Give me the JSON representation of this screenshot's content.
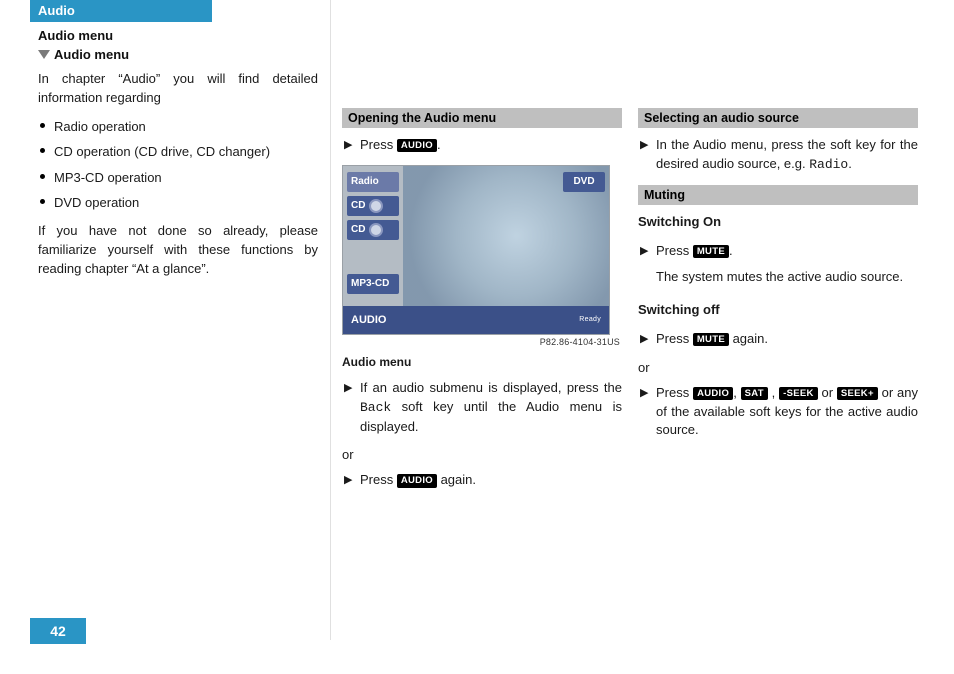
{
  "tab_title": "Audio",
  "page_number": "42",
  "col1": {
    "h1": "Audio menu",
    "h2": "Audio menu",
    "intro": "In chapter “Audio” you will find detailed information regarding",
    "bullets": [
      "Radio operation",
      "CD operation (CD drive, CD changer)",
      "MP3-CD operation",
      "DVD operation"
    ],
    "after": "If you have not done so already, please familiarize yourself with these functions by reading chapter “At a glance”."
  },
  "col2": {
    "head1": "Opening the Audio menu",
    "step1_pre": "Press ",
    "key_audio": "AUDIO",
    "step1_post": ".",
    "screen": {
      "sk_radio": "Radio",
      "sk_cd1": "CD",
      "sk_cd2": "CD",
      "sk_mp3": "MP3-CD",
      "sk_dvd": "DVD",
      "bar_title": "AUDIO",
      "bar_ready": "Ready"
    },
    "screen_code": "P82.86-4104-31US",
    "caption": "Audio menu",
    "step2_a": "If an audio submenu is displayed, press the ",
    "step2_mono": "Back",
    "step2_b": " soft key until the Audio menu is displayed.",
    "or": "or",
    "step3_pre": "Press ",
    "step3_post": " again."
  },
  "col3": {
    "head1": "Selecting an audio source",
    "step1_a": "In the Audio menu, press the soft key for the desired audio source, e.g. ",
    "step1_mono": "Radio",
    "step1_b": ".",
    "head2": "Muting",
    "sw_on_label": "Switching On",
    "on_step_pre": "Press ",
    "key_mute": "MUTE",
    "on_step_post": ".",
    "on_step_cont": "The system mutes the active audio source.",
    "sw_off_label": "Switching off",
    "off_step1_pre": "Press ",
    "off_step1_post": " again.",
    "or": "or",
    "off2_pre": "Press ",
    "key_audio": "AUDIO",
    "sep": ", ",
    "key_sat": "SAT",
    "key_seek_m": "-SEEK",
    "sep_or": " or ",
    "key_seek_p": "SEEK+",
    "off2_post": " or any of the available soft keys for the active audio source."
  }
}
